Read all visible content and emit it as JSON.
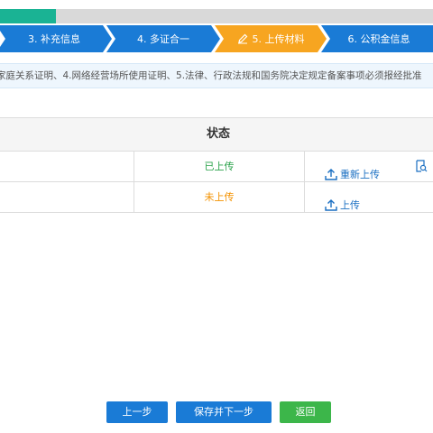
{
  "progress": {
    "fraction": 0.13,
    "fill_color": "#1ab394",
    "track_color": "#d9d9d9"
  },
  "steps": [
    {
      "label": "3. 补充信息",
      "state": "done"
    },
    {
      "label": "4. 多证合一",
      "state": "done"
    },
    {
      "label": "5. 上传材料",
      "state": "active"
    },
    {
      "label": "6. 公积金信息",
      "state": "todo"
    }
  ],
  "colors": {
    "step_blue": "#1a7bd6",
    "step_active": "#f7a520",
    "status_uploaded": "#2aa24a",
    "status_pending": "#f39200",
    "link_blue": "#1a6fc2",
    "button_blue": "#1a7bd6",
    "button_green": "#3cb64a"
  },
  "notice": {
    "text": "家庭关系证明、4.网络经营场所使用证明、5.法律、行政法规和国务院决定规定备案事项必须报经批准"
  },
  "table": {
    "header_status": "状态",
    "rows": [
      {
        "status": "已上传",
        "action_label": "重新上传",
        "action_icon": "upload-icon",
        "extra_icon": "preview-icon"
      },
      {
        "status": "未上传",
        "action_label": "上传",
        "action_icon": "upload-icon"
      }
    ]
  },
  "buttons": {
    "prev": "上一步",
    "save_next": "保存并下一步",
    "back": "返回"
  }
}
